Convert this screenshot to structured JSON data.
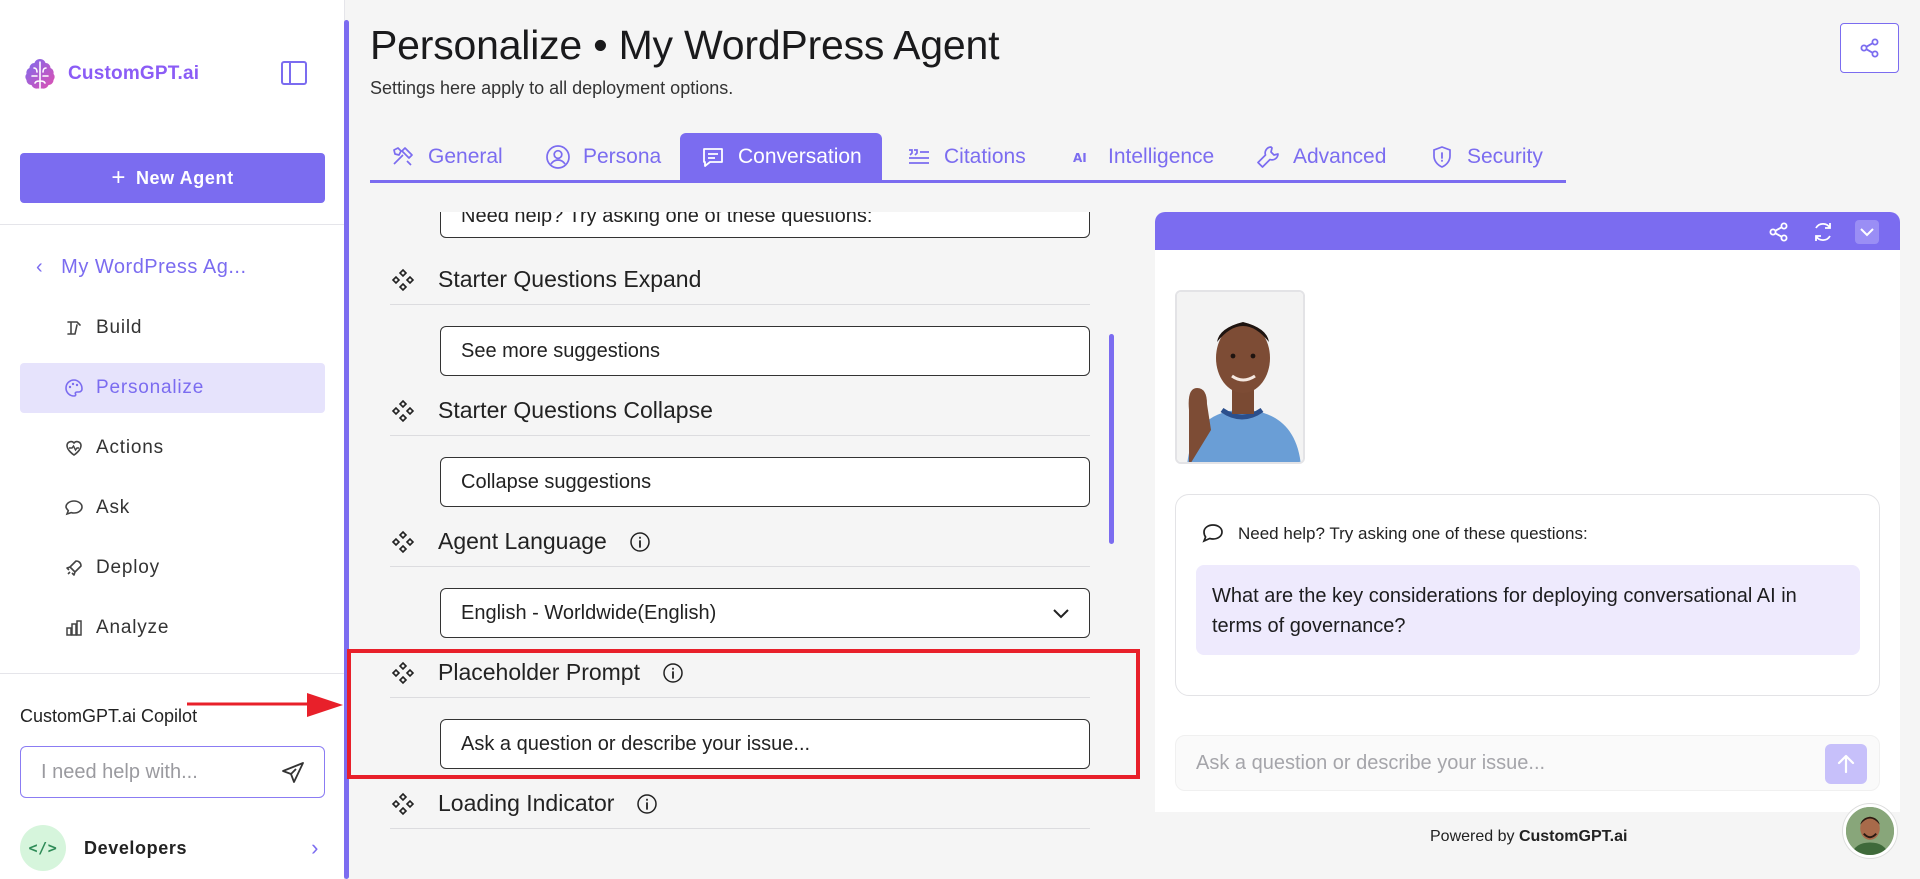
{
  "app": {
    "brand": "CustomGPT.ai"
  },
  "sidebar": {
    "new_agent_label": "New Agent",
    "agent_name": "My WordPress Ag...",
    "items": [
      {
        "label": "Build",
        "icon": "build-icon",
        "active": false
      },
      {
        "label": "Personalize",
        "icon": "palette-icon",
        "active": true
      },
      {
        "label": "Actions",
        "icon": "actions-icon",
        "active": false
      },
      {
        "label": "Ask",
        "icon": "chat-icon",
        "active": false
      },
      {
        "label": "Deploy",
        "icon": "rocket-icon",
        "active": false
      },
      {
        "label": "Analyze",
        "icon": "chart-icon",
        "active": false
      }
    ],
    "copilot": {
      "title": "CustomGPT.ai Copilot",
      "placeholder": "I need help with..."
    },
    "developers_label": "Developers"
  },
  "header": {
    "title": "Personalize • My WordPress Agent",
    "subtitle": "Settings here apply to all deployment options."
  },
  "tabs": [
    {
      "label": "General",
      "icon": "tools-icon",
      "active": false
    },
    {
      "label": "Persona",
      "icon": "user-circle-icon",
      "active": false
    },
    {
      "label": "Conversation",
      "icon": "message-icon",
      "active": true
    },
    {
      "label": "Citations",
      "icon": "quote-icon",
      "active": false
    },
    {
      "label": "Intelligence",
      "icon": "ai-icon",
      "active": false
    },
    {
      "label": "Advanced",
      "icon": "wrench-icon",
      "active": false
    },
    {
      "label": "Security",
      "icon": "shield-icon",
      "active": false
    }
  ],
  "settings": {
    "starter_title_value": "Need help? Try asking one of these questions:",
    "expand": {
      "label": "Starter Questions Expand",
      "value": "See more suggestions"
    },
    "collapse": {
      "label": "Starter Questions Collapse",
      "value": "Collapse suggestions"
    },
    "language": {
      "label": "Agent Language",
      "value": "English - Worldwide(English)"
    },
    "placeholder_prompt": {
      "label": "Placeholder Prompt",
      "value": "Ask a question or describe your issue..."
    },
    "loading_indicator": {
      "label": "Loading Indicator"
    }
  },
  "chat": {
    "starter_heading": "Need help? Try asking one of these questions:",
    "starter_question": "What are the key considerations for deploying conversational AI in terms of governance?",
    "input_placeholder": "Ask a question or describe your issue...",
    "powered_prefix": "Powered by",
    "powered_brand": "CustomGPT.ai"
  },
  "colors": {
    "accent": "#7b6cf0",
    "highlight": "#e8202a",
    "accent_light": "#e6e3fc"
  }
}
